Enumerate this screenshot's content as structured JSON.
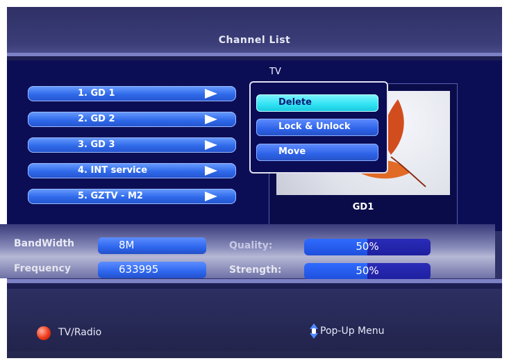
{
  "header": {
    "title": "Channel List"
  },
  "mode_label": "TV",
  "channels": [
    {
      "label": "1. GD 1",
      "icon": "play-arrow-icon"
    },
    {
      "label": "2. GD 2",
      "icon": "play-arrow-icon"
    },
    {
      "label": "3. GD 3",
      "icon": "play-arrow-icon"
    },
    {
      "label": "4. INT service",
      "icon": "play-arrow-icon"
    },
    {
      "label": "5. GZTV - M2",
      "icon": "play-arrow-icon"
    }
  ],
  "popup_menu": {
    "items": [
      {
        "label": "Delete",
        "selected": true
      },
      {
        "label": "Lock & Unlock",
        "selected": false
      },
      {
        "label": "Move",
        "selected": false
      }
    ]
  },
  "preview": {
    "caption": "GD1",
    "image": "red-leaf-on-snow"
  },
  "signal": {
    "bandwidth_label": "BandWidth",
    "bandwidth_value": "8M",
    "frequency_label": "Frequency",
    "frequency_value": "633995",
    "quality_label": "Quality:",
    "quality_text": "50%",
    "quality_fraction": 0.5,
    "strength_label": "Strength:",
    "strength_text": "50%",
    "strength_fraction": 0.5
  },
  "footer": {
    "left_label": "TV/Radio",
    "left_icon": "red-button-icon",
    "right_label": "Pop-Up Menu",
    "right_icon": "up-down-arrow-icon"
  },
  "colors": {
    "selected_menu_item": "#2ee2f2",
    "button_blue": "#2d62e8",
    "panel_navy": "#0c0e55",
    "red_button": "#f03a1a"
  }
}
